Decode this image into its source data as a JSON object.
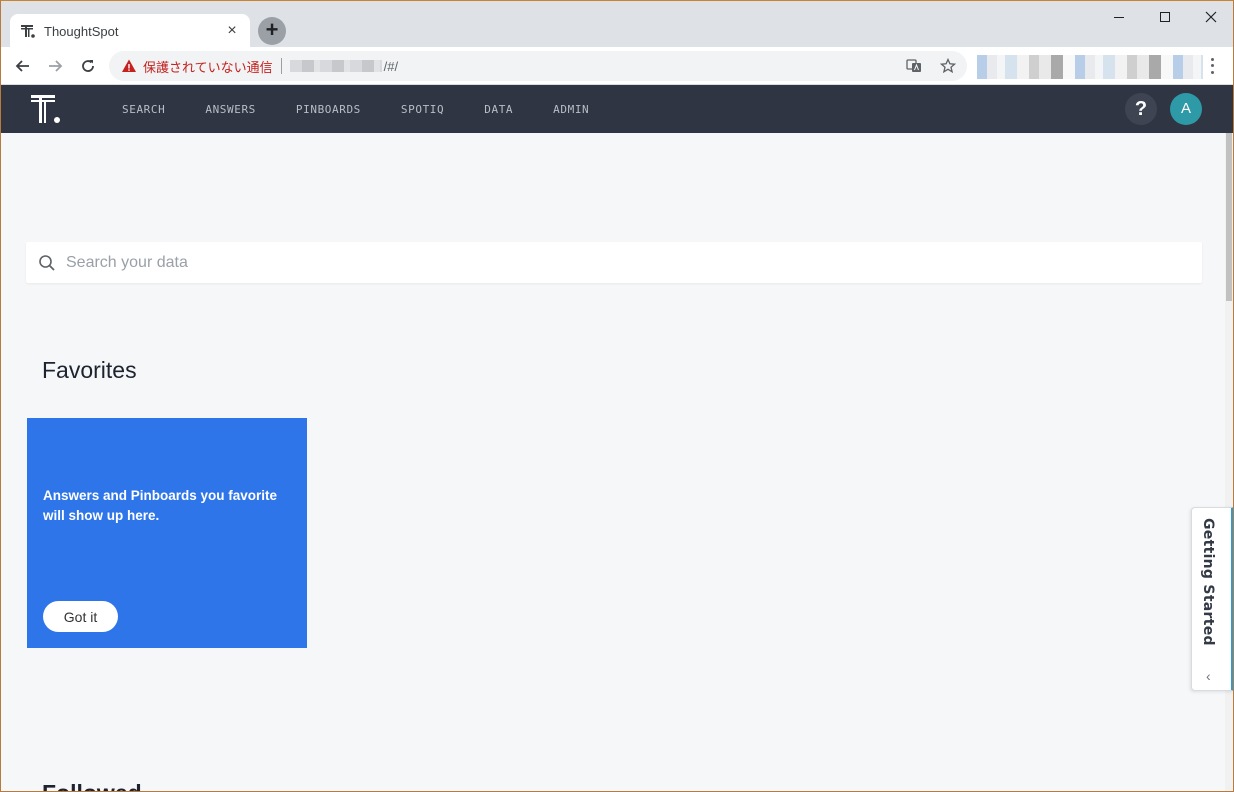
{
  "browser": {
    "tab_title": "ThoughtSpot",
    "tab_close": "×",
    "new_tab": "+",
    "security_warning": "保護されていない通信",
    "url_suffix": "/#/",
    "window_controls": {
      "minimize": "—",
      "maximize": "☐",
      "close": "✕"
    }
  },
  "app": {
    "nav": [
      "SEARCH",
      "ANSWERS",
      "PINBOARDS",
      "SPOTIQ",
      "DATA",
      "ADMIN"
    ],
    "help_label": "?",
    "avatar_initial": "A",
    "accent_color": "#2e75ea",
    "header_color": "#2f3542"
  },
  "search": {
    "placeholder": "Search your data"
  },
  "favorites": {
    "title": "Favorites",
    "empty_message": "Answers and Pinboards you favorite will show up here.",
    "got_it_label": "Got it"
  },
  "next_section": {
    "title": "Followed"
  },
  "getting_started": {
    "label": "Getting Started",
    "chevron": "‹"
  }
}
